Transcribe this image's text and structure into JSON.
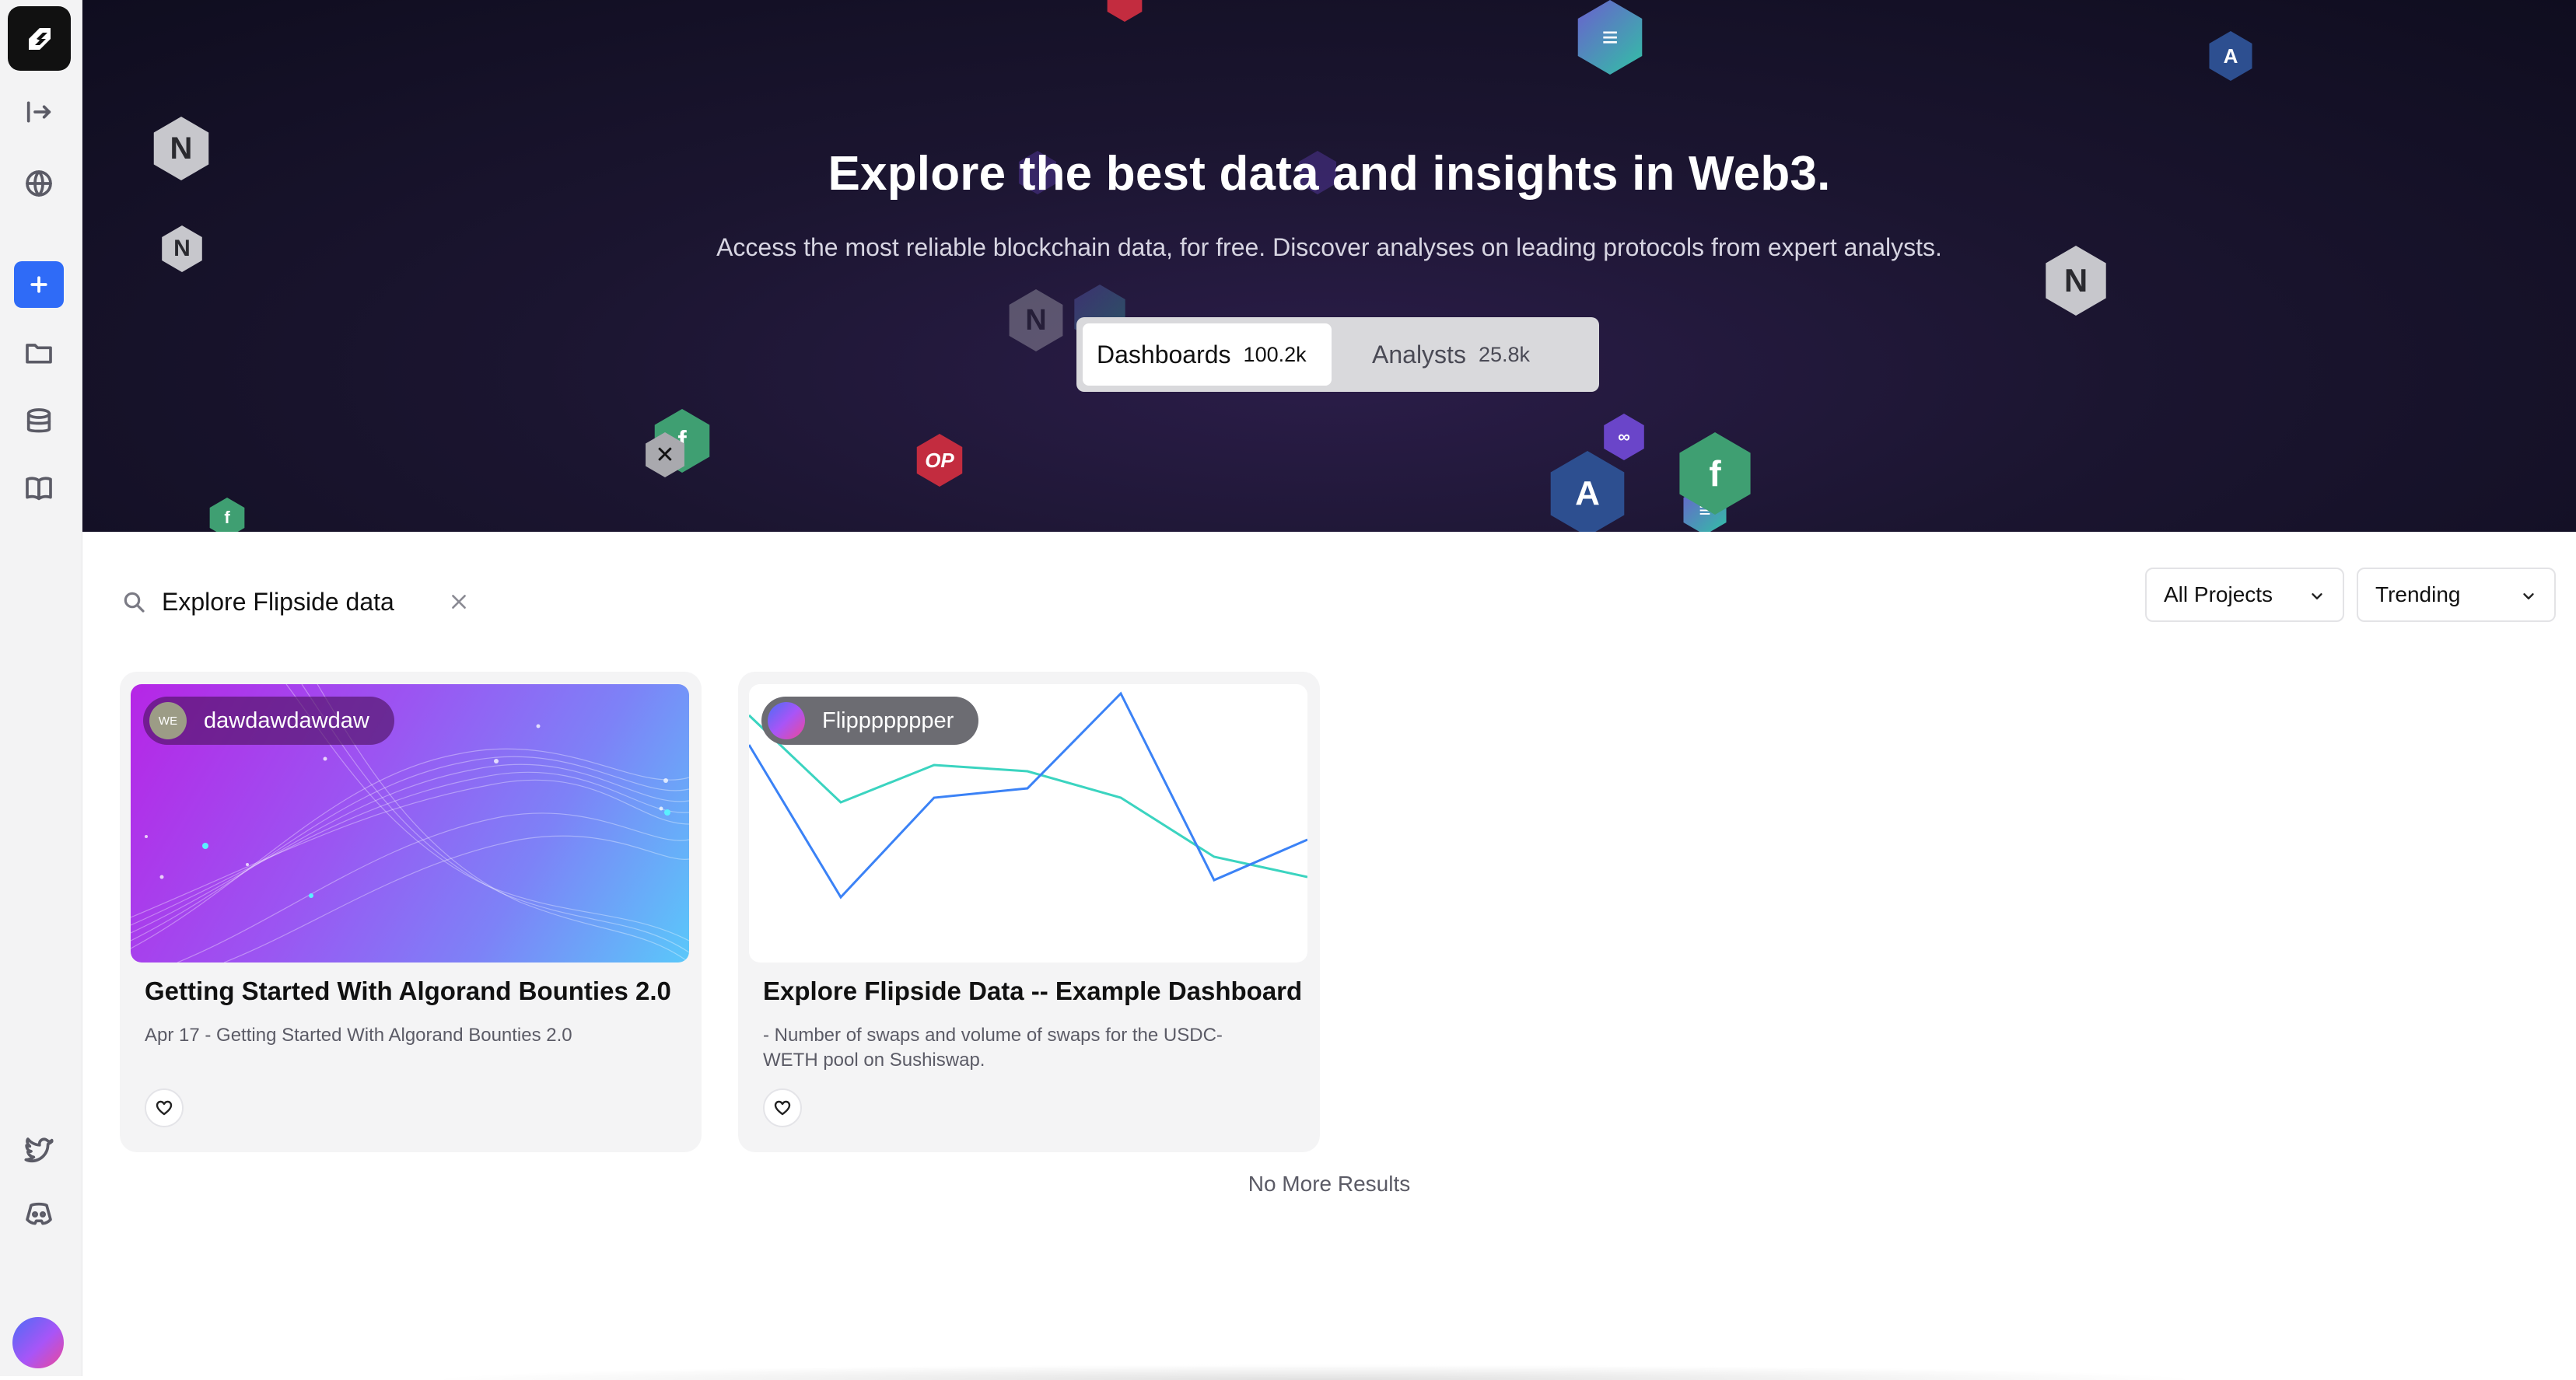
{
  "sidebar": {
    "items": [
      {
        "name": "collapse-icon"
      },
      {
        "name": "globe-icon"
      },
      {
        "name": "plus-icon"
      },
      {
        "name": "folder-icon"
      },
      {
        "name": "database-icon"
      },
      {
        "name": "book-icon"
      },
      {
        "name": "twitter-icon"
      },
      {
        "name": "discord-icon"
      }
    ]
  },
  "hero": {
    "title": "Explore the best data and insights in Web3.",
    "subtitle": "Access the most reliable blockchain data, for free. Discover analyses on leading protocols from expert analysts.",
    "tabs": [
      {
        "label": "Dashboards",
        "count": "100.2k",
        "active": true
      },
      {
        "label": "Analysts",
        "count": "25.8k",
        "active": false
      }
    ],
    "badge_op": "OP"
  },
  "filters": {
    "search_value": "Explore Flipside data",
    "projects": "All Projects",
    "sort": "Trending"
  },
  "cards": [
    {
      "author": "dawdawdawdaw",
      "author_initials": "WE",
      "title": "Getting Started With Algorand Bounties 2.0",
      "description": "Apr 17 - Getting Started With Algorand Bounties 2.0"
    },
    {
      "author": "Flippppppper",
      "title": "Explore Flipside Data -- Example Dashboard",
      "description": "- Number of swaps and volume of swaps for the USDC-WETH pool on Sushiswap."
    }
  ],
  "footer": {
    "no_more": "No More Results"
  },
  "colors": {
    "accent": "#2f6bf7",
    "hero_bg": "#1b1530",
    "line_blue": "#3b82f6",
    "line_teal": "#2dd4bf"
  }
}
